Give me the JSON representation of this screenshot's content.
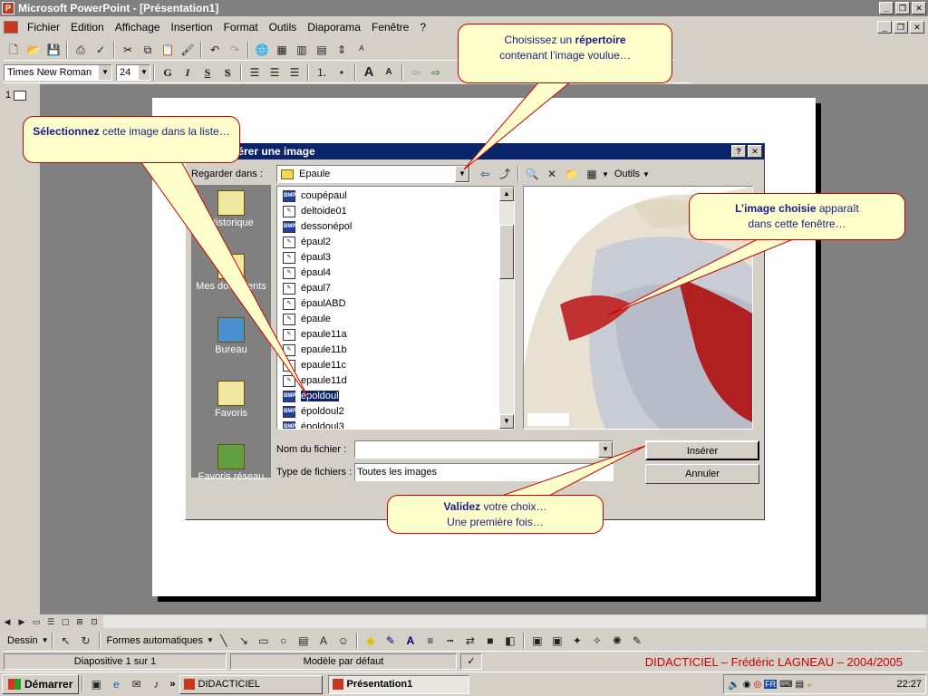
{
  "app": {
    "title": "Microsoft PowerPoint - [Présentation1]"
  },
  "menu": [
    "Fichier",
    "Edition",
    "Affichage",
    "Insertion",
    "Format",
    "Outils",
    "Diaporama",
    "Fenêtre",
    "?"
  ],
  "format_toolbar": {
    "font": "Times New Roman",
    "size": "24",
    "bold": "G",
    "italic": "I",
    "underline": "S",
    "shadow": "S"
  },
  "slide_pane": {
    "number": "1"
  },
  "dialog": {
    "title": "Insérer une image",
    "look_in_label": "Regarder dans :",
    "look_in_value": "Epaule",
    "tools_label": "Outils",
    "places": [
      "Historique",
      "Mes documents",
      "Bureau",
      "Favoris",
      "Favoris réseau"
    ],
    "files": [
      {
        "name": "coupépaul",
        "type": "bmp"
      },
      {
        "name": "deltoide01",
        "type": "img"
      },
      {
        "name": "dessonépol",
        "type": "bmp"
      },
      {
        "name": "épaul2",
        "type": "img"
      },
      {
        "name": "épaul3",
        "type": "img"
      },
      {
        "name": "épaul4",
        "type": "img"
      },
      {
        "name": "épaul7",
        "type": "img"
      },
      {
        "name": "épaulABD",
        "type": "img"
      },
      {
        "name": "épaule",
        "type": "img"
      },
      {
        "name": "epaule11a",
        "type": "img"
      },
      {
        "name": "epaule11b",
        "type": "img"
      },
      {
        "name": "epaule11c",
        "type": "img"
      },
      {
        "name": "epaule11d",
        "type": "img"
      },
      {
        "name": "époldoul",
        "type": "bmp",
        "selected": true
      },
      {
        "name": "époldoul2",
        "type": "bmp"
      },
      {
        "name": "époldoul3",
        "type": "bmp"
      }
    ],
    "filename_label": "Nom du fichier :",
    "filename_value": "",
    "filetype_label": "Type de fichiers :",
    "filetype_value": "Toutes les images",
    "insert_button": "Insérer",
    "cancel_button": "Annuler"
  },
  "callouts": {
    "directory": {
      "plain1": "Choisissez un ",
      "bold": "répertoire",
      "plain2": "contenant l’image voulue…"
    },
    "select": {
      "bold": "Sélectionnez",
      "plain": " cette image dans la liste…"
    },
    "preview": {
      "bold": "L’image choisie",
      "plain1": " apparaît",
      "plain2": "dans cette fenêtre…"
    },
    "validate": {
      "bold": "Validez",
      "plain1": " votre choix…",
      "plain2": "Une première fois…"
    }
  },
  "drawing_toolbar": {
    "draw": "Dessin",
    "autoshapes": "Formes automatiques"
  },
  "status": {
    "slide": "Diapositive 1 sur 1",
    "design": "Modèle par défaut",
    "footer": "DIDACTICIEL – Frédéric LAGNEAU – 2004/2005"
  },
  "taskbar": {
    "start": "Démarrer",
    "tasks": [
      "DIDACTICIEL",
      "Présentation1"
    ],
    "clock": "22:27",
    "lang": "FR"
  },
  "colors": {
    "titlebar_inactive": "#808080",
    "dialog_title": "#0a246a",
    "callout_bg": "#ffffcc",
    "callout_border": "#cc0000",
    "footer_text": "#cc0000"
  }
}
